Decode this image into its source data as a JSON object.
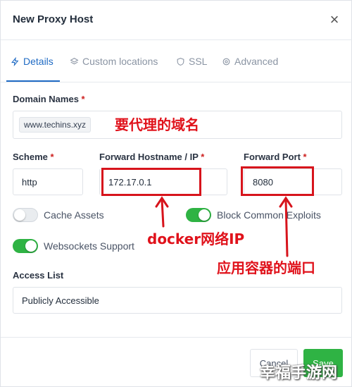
{
  "modal": {
    "title": "New Proxy Host",
    "close_label": "×"
  },
  "tabs": [
    {
      "label": "Details",
      "icon": "lightning-icon",
      "active": true
    },
    {
      "label": "Custom locations",
      "icon": "layers-icon"
    },
    {
      "label": "SSL",
      "icon": "shield-icon"
    },
    {
      "label": "Advanced",
      "icon": "gear-icon"
    }
  ],
  "form": {
    "domain_names": {
      "label": "Domain Names",
      "required": "*",
      "tag": "www.techins.xyz"
    },
    "scheme": {
      "label": "Scheme",
      "required": "*",
      "value": "http"
    },
    "forward_host": {
      "label": "Forward Hostname / IP",
      "required": "*",
      "value": "172.17.0.1"
    },
    "forward_port": {
      "label": "Forward Port",
      "required": "*",
      "value": "8080"
    },
    "cache_assets": {
      "label": "Cache Assets",
      "enabled": false
    },
    "block_exploits": {
      "label": "Block Common Exploits",
      "enabled": true
    },
    "websockets": {
      "label": "Websockets Support",
      "enabled": true
    },
    "access_list": {
      "label": "Access List",
      "value": "Publicly Accessible"
    }
  },
  "footer": {
    "cancel_label": "Cancel",
    "save_label": "Save"
  },
  "annotations": {
    "domain": "要代理的域名",
    "docker_ip": "docker网络IP",
    "port": "应用容器的端口"
  },
  "watermark": "幸福手游网",
  "colors": {
    "accent": "#206bc4",
    "success": "#2fb344",
    "annotation": "#e0121b",
    "required": "#cd201f"
  }
}
